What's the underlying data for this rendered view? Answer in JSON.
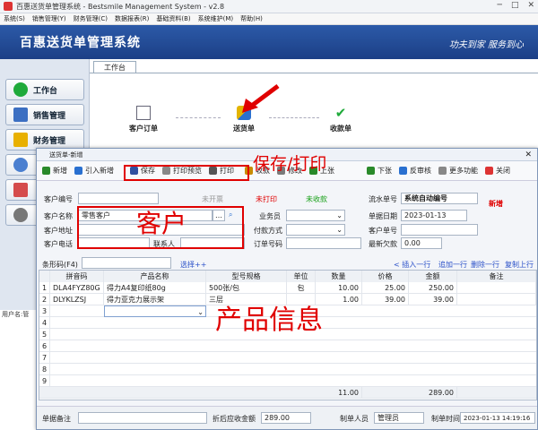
{
  "main": {
    "title": "百惠送货单管理系统 - Bestsmile Management System - v2.8",
    "menu": [
      "系统(S)",
      "销售管理(Y)",
      "财务管理(C)",
      "数据报表(R)",
      "基础资料(B)",
      "系统维护(M)",
      "帮助(H)"
    ],
    "banner_title": "百惠送货单管理系统",
    "banner_slogan": "功夫到家 服务到心",
    "left_buttons": [
      {
        "label": "工作台",
        "icon": "check-circle-icon",
        "color": "#1faa3a"
      },
      {
        "label": "销售管理",
        "icon": "document-icon",
        "color": "#3c6fc2"
      },
      {
        "label": "财务管理",
        "icon": "folder-icon",
        "color": "#e8b000"
      }
    ],
    "workspace_tab": "工作台",
    "flow": [
      "客户订单",
      "送货单",
      "收款单"
    ],
    "status_user": "用户名:管"
  },
  "dialog": {
    "title": "送货单-新增",
    "toolbar": [
      "新增",
      "引入新增",
      "保存",
      "打印预览",
      "打印",
      "收款",
      "修改",
      "上张",
      "下张",
      "反审核",
      "更多功能",
      "关闭"
    ],
    "labels": {
      "customer_code": "客户编号",
      "customer_name": "客户名称",
      "customer_addr": "客户地址",
      "customer_phone": "客户电话",
      "contact": "联系人",
      "salesman": "业务员",
      "payment": "付款方式",
      "order_no": "订单号码",
      "serial_no": "流水单号",
      "bill_date": "单据日期",
      "customer_bill": "客户单号",
      "last_debt": "最新欠款",
      "barcode": "条形码(F4)",
      "select": "选择++",
      "insert_row": "< 插入一行",
      "append_row": "追加一行",
      "delete_row": "删除一行",
      "copy_row": "复制上行"
    },
    "status": {
      "not_invoiced": "未开票",
      "not_printed": "未打印",
      "not_received": "未收款",
      "new": "新增"
    },
    "values": {
      "customer_name": "零售客户",
      "serial_no": "系统自动编号",
      "bill_date": "2023-01-13",
      "last_debt": "0.00"
    },
    "table": {
      "headers": [
        "拼音码",
        "产品名称",
        "型号规格",
        "单位",
        "数量",
        "价格",
        "金额",
        "备注"
      ],
      "rows": [
        [
          "DLA4FYZ80G",
          "得力A4复印纸80g",
          "500张/包",
          "包",
          "10.00",
          "25.00",
          "250.00",
          ""
        ],
        [
          "DLYKLZSJ",
          "得力亚克力展示架",
          "三层",
          "",
          "1.00",
          "39.00",
          "39.00",
          ""
        ]
      ],
      "total_qty": "11.00",
      "total_amount": "289.00"
    },
    "footer": {
      "remark_label": "单据备注",
      "discount_label": "折后应收金额",
      "discount_value": "289.00",
      "maker_label": "制单人员",
      "maker_value": "管理员",
      "time_label": "制单时间",
      "time_value": "2023-01-13 14:19:16"
    }
  },
  "annotations": {
    "save_print": "保存/打印",
    "customer": "客户",
    "product_info": "产品信息"
  },
  "colors": {
    "accent_red": "#e00000",
    "banner_blue": "#1f4a96"
  }
}
